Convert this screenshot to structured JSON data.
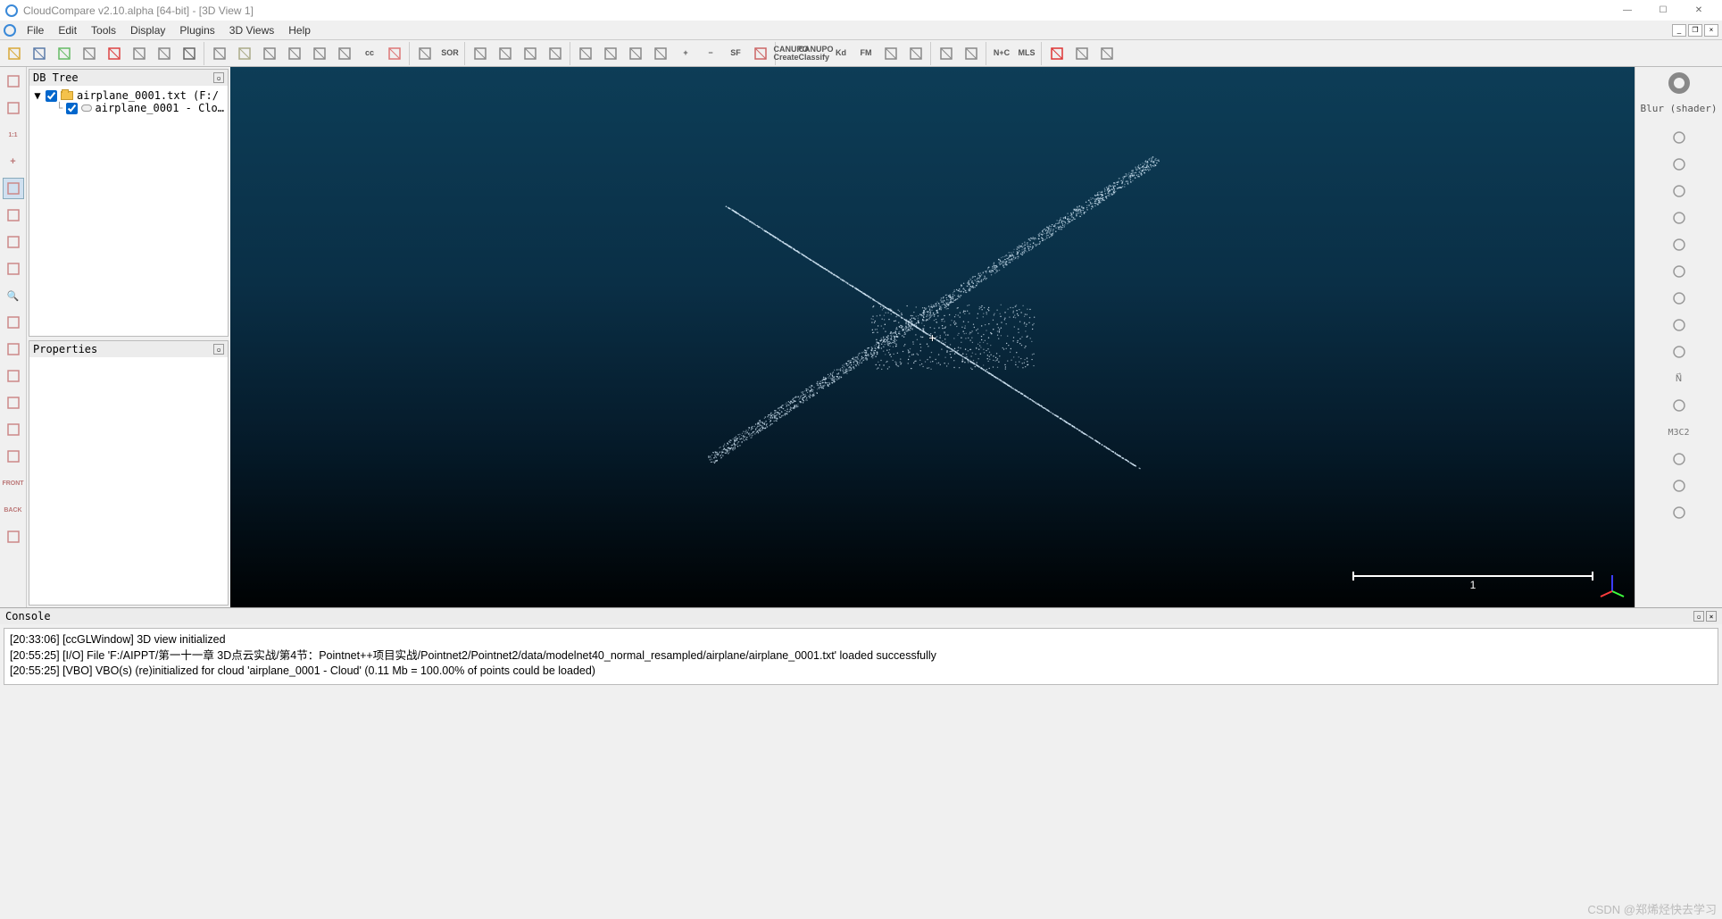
{
  "title": "CloudCompare v2.10.alpha [64-bit] - [3D View 1]",
  "menus": [
    "File",
    "Edit",
    "Tools",
    "Display",
    "Plugins",
    "3D Views",
    "Help"
  ],
  "toolbar": [
    {
      "n": "open",
      "t": "svg",
      "c": "#d8a838"
    },
    {
      "n": "save",
      "t": "svg",
      "c": "#5a7aa8"
    },
    {
      "n": "pick",
      "t": "svg",
      "c": "#6b6"
    },
    {
      "n": "props",
      "t": "svg",
      "c": "#888"
    },
    {
      "n": "pick-rot",
      "t": "svg",
      "c": "#d44"
    },
    {
      "n": "clone",
      "t": "svg",
      "c": "#888"
    },
    {
      "n": "merge",
      "t": "svg",
      "c": "#888"
    },
    {
      "n": "delete",
      "t": "svg",
      "c": "#666"
    },
    {
      "n": "sep"
    },
    {
      "n": "point",
      "t": "svg",
      "c": "#888"
    },
    {
      "n": "pin",
      "t": "svg",
      "c": "#aa8"
    },
    {
      "n": "sample",
      "t": "svg",
      "c": "#888"
    },
    {
      "n": "subsample",
      "t": "svg",
      "c": "#888"
    },
    {
      "n": "scale",
      "t": "svg",
      "c": "#888"
    },
    {
      "n": "multiply",
      "t": "svg",
      "c": "#888"
    },
    {
      "n": "cc",
      "t": "txt",
      "l": "cc"
    },
    {
      "n": "colorize",
      "t": "svg",
      "c": "#d77"
    },
    {
      "n": "sep"
    },
    {
      "n": "raster",
      "t": "svg",
      "c": "#888"
    },
    {
      "n": "sor",
      "t": "txt",
      "l": "SOR"
    },
    {
      "n": "sep"
    },
    {
      "n": "graph",
      "t": "svg",
      "c": "#888"
    },
    {
      "n": "register",
      "t": "svg",
      "c": "#888"
    },
    {
      "n": "plane",
      "t": "svg",
      "c": "#888"
    },
    {
      "n": "ruler",
      "t": "svg",
      "c": "#888"
    },
    {
      "n": "sep"
    },
    {
      "n": "hist",
      "t": "svg",
      "c": "#888"
    },
    {
      "n": "hist2",
      "t": "svg",
      "c": "#888"
    },
    {
      "n": "stat",
      "t": "svg",
      "c": "#888"
    },
    {
      "n": "grid",
      "t": "svg",
      "c": "#888"
    },
    {
      "n": "add",
      "t": "txt",
      "l": "+"
    },
    {
      "n": "remove",
      "t": "txt",
      "l": "−"
    },
    {
      "n": "sf",
      "t": "txt",
      "l": "SF"
    },
    {
      "n": "palette",
      "t": "svg",
      "c": "#c66"
    },
    {
      "n": "sep"
    },
    {
      "n": "canupo-c",
      "t": "txt",
      "l": "CANUPO\nCreate"
    },
    {
      "n": "canupo-cl",
      "t": "txt",
      "l": "CANUPO\nClassify"
    },
    {
      "n": "kd",
      "t": "txt",
      "l": "Kd"
    },
    {
      "n": "fm",
      "t": "txt",
      "l": "FM"
    },
    {
      "n": "tool1",
      "t": "svg",
      "c": "#888"
    },
    {
      "n": "tool2",
      "t": "svg",
      "c": "#888"
    },
    {
      "n": "sep"
    },
    {
      "n": "globe",
      "t": "svg",
      "c": "#888"
    },
    {
      "n": "globe2",
      "t": "svg",
      "c": "#888"
    },
    {
      "n": "sep"
    },
    {
      "n": "nc",
      "t": "txt",
      "l": "N+C"
    },
    {
      "n": "mls",
      "t": "txt",
      "l": "MLS"
    },
    {
      "n": "sep"
    },
    {
      "n": "curve",
      "t": "svg",
      "c": "#d33"
    },
    {
      "n": "curve2",
      "t": "svg",
      "c": "#888"
    },
    {
      "n": "curve3",
      "t": "svg",
      "c": "#888"
    }
  ],
  "lefttools": [
    {
      "n": "wand"
    },
    {
      "n": "camera"
    },
    {
      "n": "ratio",
      "l": "1:1"
    },
    {
      "n": "plus",
      "l": "+"
    },
    {
      "n": "auto",
      "active": true
    },
    {
      "n": "align"
    },
    {
      "n": "box"
    },
    {
      "n": "move"
    },
    {
      "n": "zoom",
      "l": "🔍"
    },
    {
      "n": "cube1"
    },
    {
      "n": "cube2"
    },
    {
      "n": "cube3"
    },
    {
      "n": "cube4"
    },
    {
      "n": "cube5"
    },
    {
      "n": "cube6"
    },
    {
      "n": "front",
      "l": "FRONT"
    },
    {
      "n": "back",
      "l": "BACK"
    },
    {
      "n": "misc"
    }
  ],
  "righttools": {
    "blur_label": "Blur (shader)",
    "items": [
      {
        "n": "blur-icon"
      },
      {
        "n": "rt1"
      },
      {
        "n": "rt2"
      },
      {
        "n": "rt-movie"
      },
      {
        "n": "rt-broom"
      },
      {
        "n": "rt-compass"
      },
      {
        "n": "rt-shield"
      },
      {
        "n": "rt-sf"
      },
      {
        "n": "rt-ellipse"
      },
      {
        "n": "rt-normal",
        "l": "N⃗"
      },
      {
        "n": "rt-bulb"
      },
      {
        "n": "rt-m3c2",
        "l": "M3C2"
      },
      {
        "n": "rt-tex"
      },
      {
        "n": "rt-sphere"
      },
      {
        "n": "rt-mix"
      }
    ]
  },
  "dbtree": {
    "title": "DB Tree",
    "root": {
      "label": "airplane_0001.txt (F:/",
      "checked": true
    },
    "child": {
      "label": "airplane_0001 - Clo…",
      "checked": true
    }
  },
  "properties": {
    "title": "Properties"
  },
  "viewport": {
    "scale_label": "1"
  },
  "console": {
    "title": "Console",
    "lines": [
      "[20:33:06] [ccGLWindow] 3D view initialized",
      "[20:55:25] [I/O] File 'F:/AIPPT/第一十一章 3D点云实战/第4节：Pointnet++项目实战/Pointnet2/Pointnet2/data/modelnet40_normal_resampled/airplane/airplane_0001.txt' loaded successfully",
      "[20:55:25] [VBO] VBO(s) (re)initialized for cloud 'airplane_0001 - Cloud' (0.11 Mb = 100.00% of points could be loaded)"
    ]
  },
  "watermark": "CSDN @郑烯烃快去学习"
}
